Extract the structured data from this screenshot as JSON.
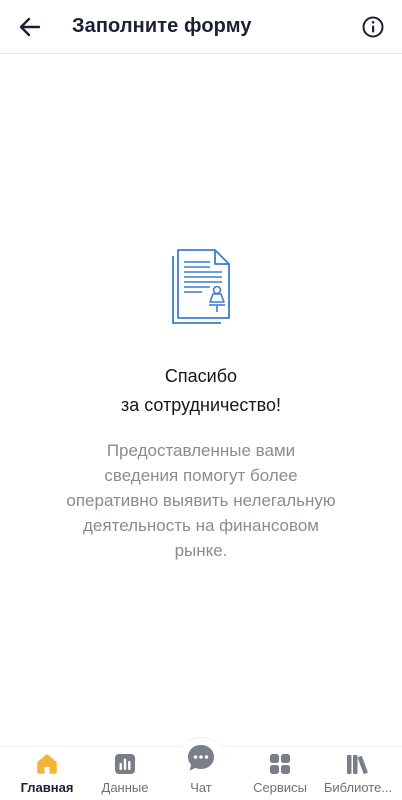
{
  "header": {
    "title": "Заполните форму",
    "back_icon": "arrow-left-icon",
    "info_icon": "info-circle-icon"
  },
  "content": {
    "illustration_icon": "document-signature-icon",
    "thanks_line1": "Спасибо",
    "thanks_line2": "за сотрудничество!",
    "description_lines": [
      "Предоставленные вами",
      "сведения помогут более",
      "оперативно выявить нелегальную",
      "деятельность на финансовом",
      "рынке."
    ]
  },
  "bottom_nav": {
    "items": [
      {
        "label": "Главная",
        "icon": "home-icon",
        "active": true
      },
      {
        "label": "Данные",
        "icon": "bar-chart-icon",
        "active": false
      },
      {
        "label": "Чат",
        "icon": "chat-bubble-icon",
        "active": false
      },
      {
        "label": "Сервисы",
        "icon": "grid-icon",
        "active": false
      },
      {
        "label": "Библиоте...",
        "icon": "books-icon",
        "active": false
      }
    ]
  },
  "colors": {
    "accent": "#f2b53a",
    "illustration": "#3d7ec8",
    "title": "#1c2035",
    "muted_text": "#8a8c93",
    "nav_icon": "#7a7e88"
  }
}
